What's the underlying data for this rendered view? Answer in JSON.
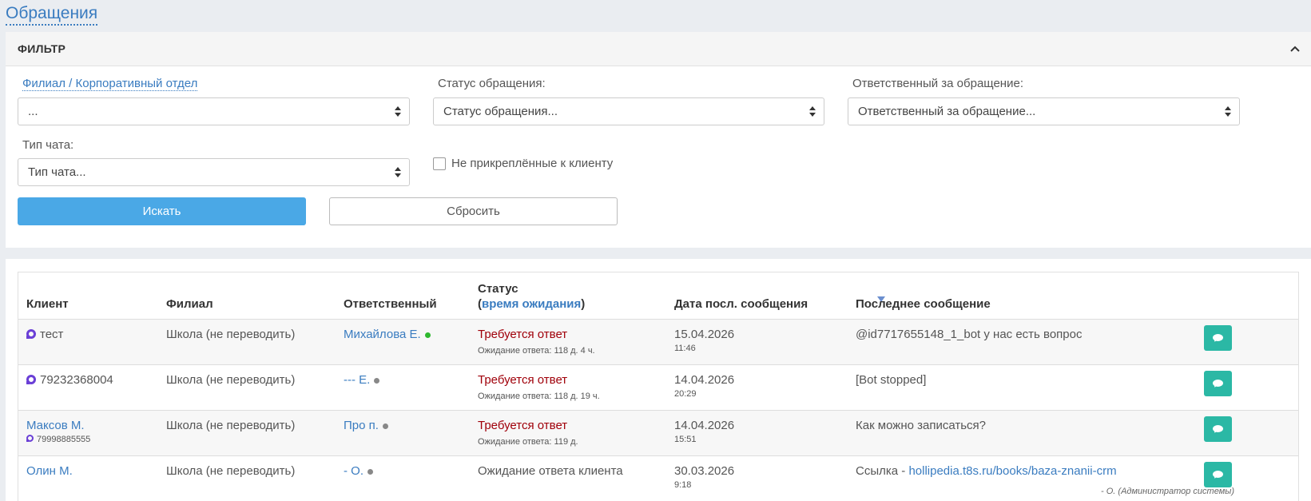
{
  "page": {
    "title": "Обращения"
  },
  "filter": {
    "title": "ФИЛЬТР",
    "collapse_icon": "chevron-up-icon",
    "branch_label": "Филиал / Корпоративный отдел",
    "branch_value": "...",
    "status_label": "Статус обращения:",
    "status_value": "Статус обращения...",
    "responsible_label": "Ответственный за обращение:",
    "responsible_value": "Ответственный за обращение...",
    "chat_type_label": "Тип чата:",
    "chat_type_value": "Тип чата...",
    "unattached_label": "Не прикреплённые к клиенту",
    "unattached_checked": false,
    "search_button": "Искать",
    "reset_button": "Сбросить"
  },
  "table": {
    "columns": {
      "client": "Клиент",
      "branch": "Филиал",
      "responsible": "Ответственный",
      "status": "Статус",
      "status_open": "(",
      "status_wait": "время ожидания",
      "status_close": ")",
      "last_date": "Дата посл. сообщения",
      "last_message": "Последнее сообщение"
    },
    "rows": [
      {
        "client": "тест",
        "client_phone": "",
        "branch": "Школа (не переводить)",
        "responsible": "Михайлова Е.",
        "responsible_status_color": "#2eb82e",
        "status": "Требуется ответ",
        "wait": "Ожидание ответа: 118 д. 4 ч.",
        "date": "15.04.2026",
        "time": "11:46",
        "message": "@id7717655148_1_bot у нас есть вопрос"
      },
      {
        "client": "79232368004",
        "client_phone": "",
        "branch": "Школа (не переводить)",
        "responsible": "--- Е.",
        "responsible_status_color": "#888888",
        "status": "Требуется ответ",
        "wait": "Ожидание ответа: 118 д. 19 ч.",
        "date": "14.04.2026",
        "time": "20:29",
        "message": "[Bot stopped]"
      },
      {
        "client": "Максов М.",
        "client_phone": "79998885555",
        "branch": "Школа (не переводить)",
        "responsible": "Про п.",
        "responsible_status_color": "#888888",
        "status": "Требуется ответ",
        "wait": "Ожидание ответа: 119 д.",
        "date": "14.04.2026",
        "time": "15:51",
        "message": "Как можно записаться?"
      },
      {
        "client": "Олин М.",
        "client_phone": "",
        "branch": "Школа (не переводить)",
        "responsible": "- О.",
        "responsible_status_color": "#888888",
        "status": "Ожидание ответа клиента",
        "wait": "",
        "date": "30.03.2026",
        "time": "9:18",
        "message_prefix": "Ссылка - ",
        "message_link": "hollipedia.t8s.ru/books/baza-znanii-crm",
        "message_author": "- О. (Администратор системы)"
      }
    ]
  }
}
